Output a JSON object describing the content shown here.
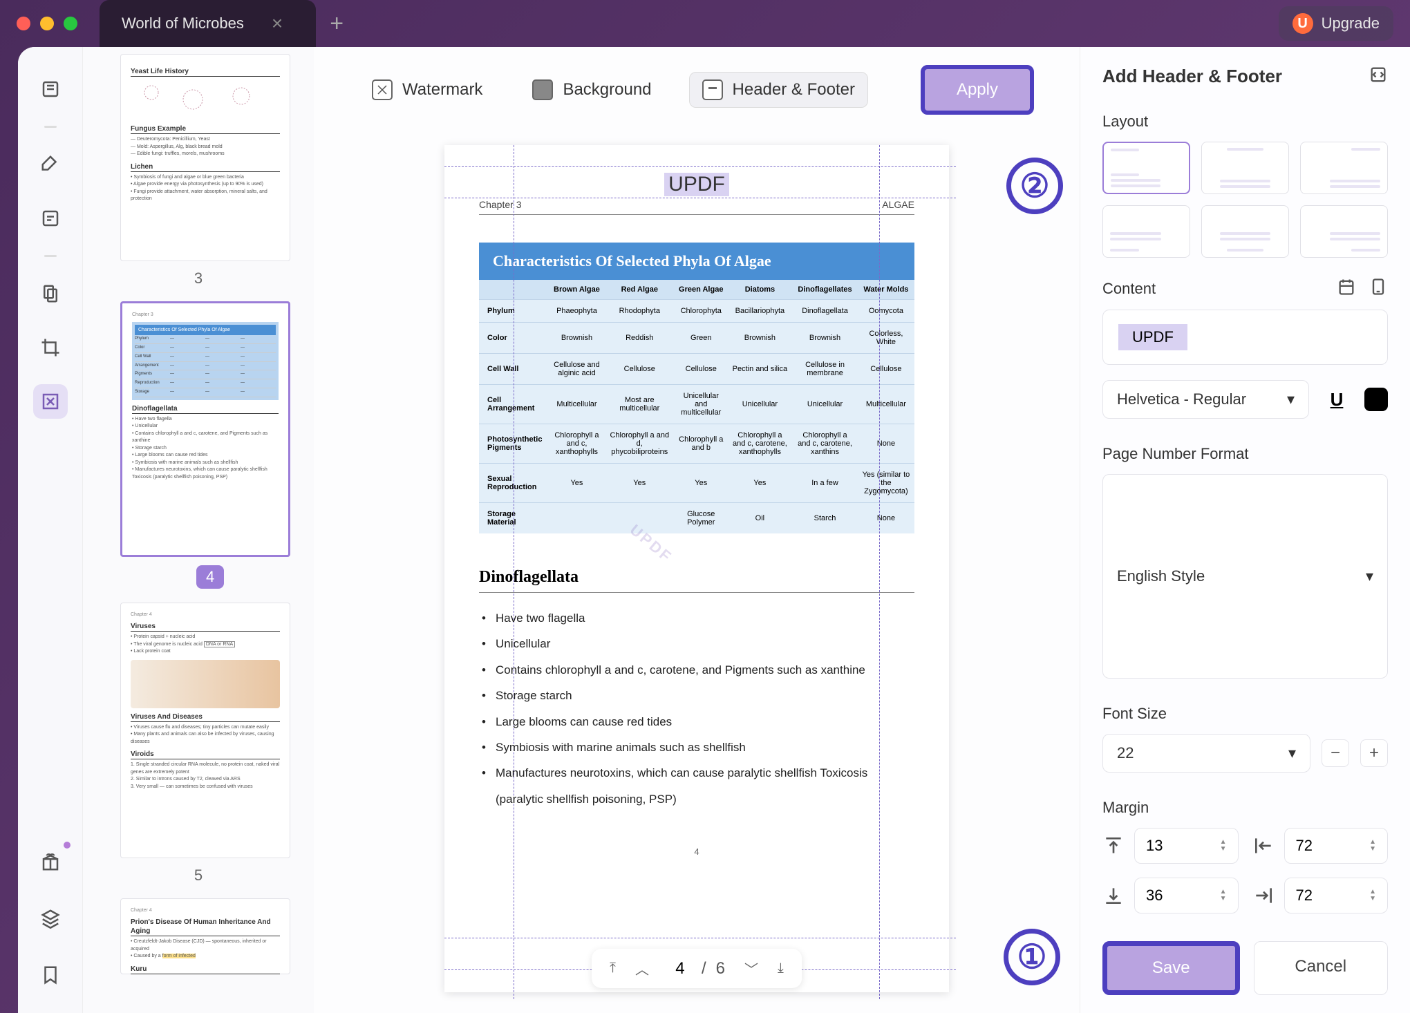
{
  "titlebar": {
    "tab_title": "World of Microbes",
    "upgrade_label": "Upgrade",
    "u_badge": "U"
  },
  "toolbar": {
    "watermark": "Watermark",
    "background": "Background",
    "header_footer": "Header & Footer",
    "apply": "Apply"
  },
  "annotations": {
    "circle1": "①",
    "circle2": "②"
  },
  "thumbnails": {
    "page3": {
      "num": "3",
      "heading1": "Yeast Life History",
      "heading2": "Fungus Example",
      "heading3": "Lichen"
    },
    "page4": {
      "num": "4",
      "table_title": "Characteristics Of Selected Phyla Of Algae",
      "section": "Dinoflagellata"
    },
    "page5": {
      "num": "5",
      "heading1": "Viruses",
      "heading2": "Viruses And Diseases",
      "heading3": "Viroids"
    },
    "page6": {
      "heading1": "Prion's Disease Of Human Inheritance And Aging",
      "heading2": "Kuru"
    }
  },
  "doc": {
    "watermark_text": "UPDF",
    "chapter": "Chapter 3",
    "subject": "ALGAE",
    "table_title": "Characteristics Of Selected Phyla Of Algae",
    "table_headers": [
      "",
      "Brown Algae",
      "Red Algae",
      "Green Algae",
      "Diatoms",
      "Dinoflagellates",
      "Water Molds"
    ],
    "table_rows": [
      [
        "Phylum",
        "Phaeophyta",
        "Rhodophyta",
        "Chlorophyta",
        "Bacillariophyta",
        "Dinoflagellata",
        "Oomycota"
      ],
      [
        "Color",
        "Brownish",
        "Reddish",
        "Green",
        "Brownish",
        "Brownish",
        "Colorless, White"
      ],
      [
        "Cell Wall",
        "Cellulose and alginic acid",
        "Cellulose",
        "Cellulose",
        "Pectin and silica",
        "Cellulose in membrane",
        "Cellulose"
      ],
      [
        "Cell Arrangement",
        "Multicellular",
        "Most are multicellular",
        "Unicellular and multicellular",
        "Unicellular",
        "Unicellular",
        "Multicellular"
      ],
      [
        "Photosynthetic Pigments",
        "Chlorophyll a and c, xanthophylls",
        "Chlorophyll a and d, phycobiliproteins",
        "Chlorophyll a and b",
        "Chlorophyll a and c, carotene, xanthophylls",
        "Chlorophyll a and c, carotene, xanthins",
        "None"
      ],
      [
        "Sexual Reproduction",
        "Yes",
        "Yes",
        "Yes",
        "Yes",
        "In a few",
        "Yes (similar to the Zygomycota)"
      ],
      [
        "Storage Material",
        "",
        "",
        "Glucose Polymer",
        "Oil",
        "Starch",
        "None"
      ]
    ],
    "section_title": "Dinoflagellata",
    "bullets": [
      "Have two flagella",
      "Unicellular",
      "Contains chlorophyll a and c, carotene, and Pigments such as xanthine",
      "Storage starch",
      "Large blooms can cause red tides",
      "Symbiosis with marine animals such as shellfish",
      "Manufactures neurotoxins, which can cause paralytic shellfish Toxicosis (paralytic shellfish poisoning, PSP)"
    ],
    "page_number": "4"
  },
  "page_nav": {
    "current": "4",
    "sep": "/",
    "total": "6"
  },
  "right_panel": {
    "title": "Add Header & Footer",
    "layout_label": "Layout",
    "content_label": "Content",
    "content_value": "UPDF",
    "font_name": "Helvetica - Regular",
    "page_number_format_label": "Page Number Format",
    "page_number_format_value": "English Style",
    "font_size_label": "Font Size",
    "font_size_value": "22",
    "margin_label": "Margin",
    "margin_top": "13",
    "margin_left": "72",
    "margin_bottom": "36",
    "margin_right": "72",
    "save": "Save",
    "cancel": "Cancel"
  }
}
